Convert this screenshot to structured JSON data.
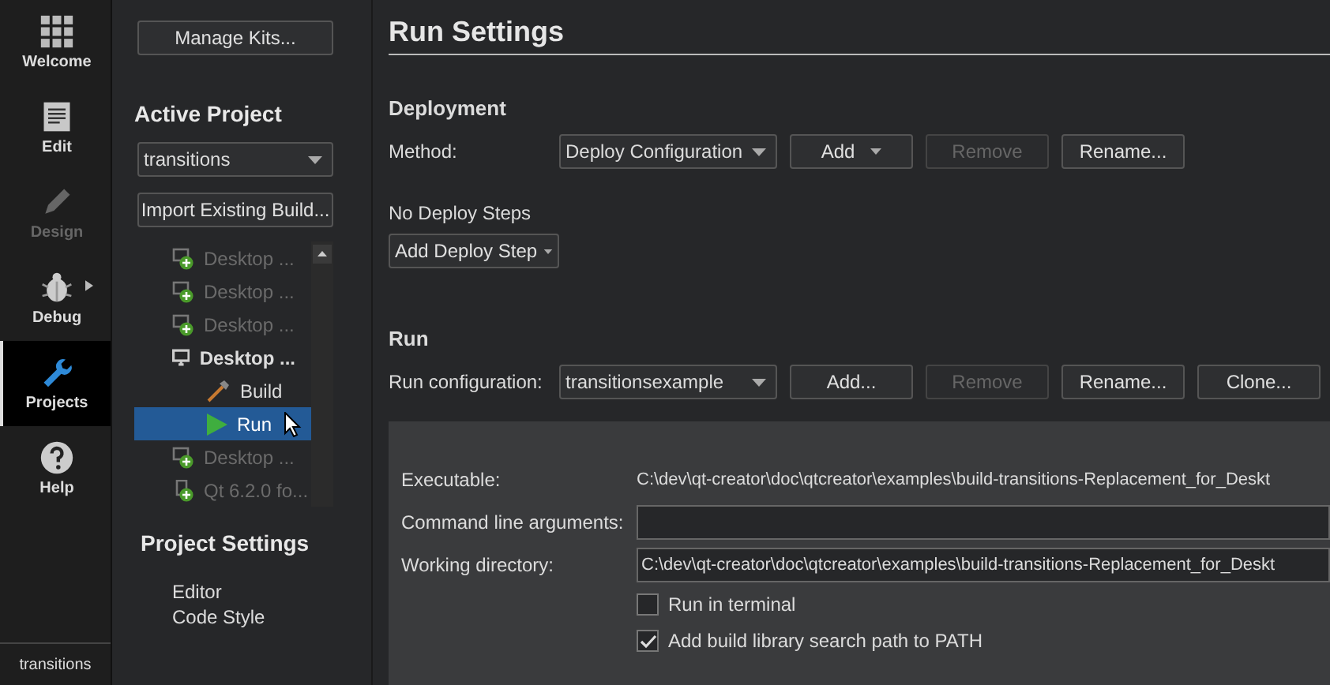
{
  "mode_bar": {
    "modes": [
      {
        "label": "Welcome",
        "kind": "welcome",
        "selected": false,
        "disabled": false,
        "has_menu": false
      },
      {
        "label": "Edit",
        "kind": "edit",
        "selected": false,
        "disabled": false,
        "has_menu": false
      },
      {
        "label": "Design",
        "kind": "design",
        "selected": false,
        "disabled": true,
        "has_menu": false
      },
      {
        "label": "Debug",
        "kind": "debug",
        "selected": false,
        "disabled": false,
        "has_menu": true
      },
      {
        "label": "Projects",
        "kind": "projects",
        "selected": true,
        "disabled": false,
        "has_menu": false
      },
      {
        "label": "Help",
        "kind": "help",
        "selected": false,
        "disabled": false,
        "has_menu": false
      }
    ],
    "target": "transitions"
  },
  "projects_panel": {
    "manage_kits": "Manage Kits...",
    "active_project_heading": "Active Project",
    "project_select": {
      "value": "transitions"
    },
    "import_button": "Import Existing Build...",
    "kits": [
      {
        "label": "Desktop ...",
        "kind": "kit",
        "enabled": false,
        "active": false,
        "selected": false
      },
      {
        "label": "Desktop ...",
        "kind": "kit",
        "enabled": false,
        "active": false,
        "selected": false
      },
      {
        "label": "Desktop ...",
        "kind": "kit",
        "enabled": false,
        "active": false,
        "selected": false
      },
      {
        "label": "Desktop ...",
        "kind": "kit",
        "enabled": true,
        "active": true,
        "selected": false,
        "children": [
          {
            "label": "Build",
            "kind": "build",
            "selected": false
          },
          {
            "label": "Run",
            "kind": "run",
            "selected": true
          }
        ]
      },
      {
        "label": "Desktop ...",
        "kind": "kit",
        "enabled": false,
        "active": false,
        "selected": false
      },
      {
        "label": "Qt 6.2.0 fo...",
        "kind": "qt",
        "enabled": false,
        "active": false,
        "selected": false
      }
    ],
    "settings_heading": "Project Settings",
    "settings_items": [
      "Editor",
      "Code Style"
    ]
  },
  "run_settings": {
    "title": "Run Settings",
    "deployment": {
      "heading": "Deployment",
      "method_label": "Method:",
      "method_select": {
        "value": "Deploy Configuration"
      },
      "buttons": [
        {
          "label": "Add",
          "kind": "menu",
          "disabled": false
        },
        {
          "label": "Remove",
          "kind": "plain",
          "disabled": true
        },
        {
          "label": "Rename...",
          "kind": "plain",
          "disabled": false
        }
      ],
      "no_steps": "No Deploy Steps",
      "add_step": "Add Deploy Step"
    },
    "run": {
      "heading": "Run",
      "config_label": "Run configuration:",
      "config_select": {
        "value": "transitionsexample"
      },
      "buttons": [
        {
          "label": "Add...",
          "disabled": false
        },
        {
          "label": "Remove",
          "disabled": true
        },
        {
          "label": "Rename...",
          "disabled": false
        },
        {
          "label": "Clone...",
          "disabled": false
        }
      ],
      "executable_label": "Executable:",
      "executable": "C:\\dev\\qt-creator\\doc\\qtcreator\\examples\\build-transitions-Replacement_for_Deskt",
      "arguments_label": "Command line arguments:",
      "workdir_label": "Working directory:",
      "workdir": "C:\\dev\\qt-creator\\doc\\qtcreator\\examples\\build-transitions-Replacement_for_Deskt",
      "checkboxes": [
        {
          "label": "Run in terminal",
          "checked": false
        },
        {
          "label": "Add build library search path to PATH",
          "checked": true
        }
      ]
    }
  }
}
